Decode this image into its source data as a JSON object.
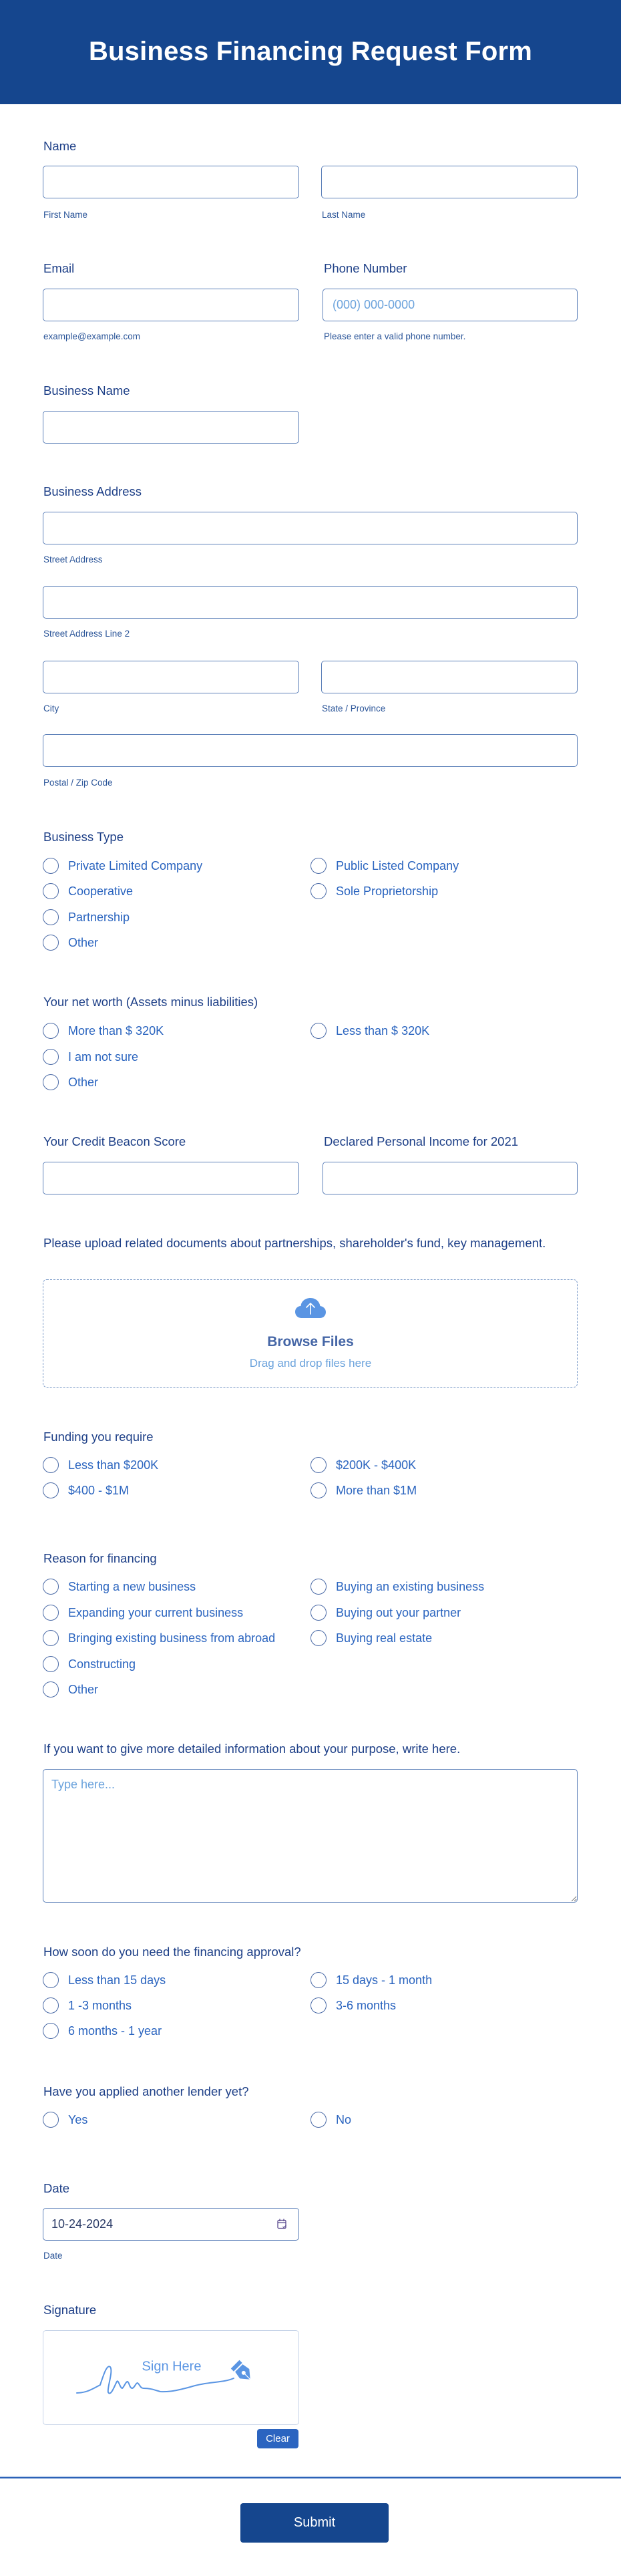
{
  "header": {
    "title": "Business Financing Request Form"
  },
  "name": {
    "label": "Name",
    "first": {
      "value": "",
      "sublabel": "First Name"
    },
    "last": {
      "value": "",
      "sublabel": "Last Name"
    }
  },
  "email": {
    "label": "Email",
    "value": "",
    "sublabel": "example@example.com"
  },
  "phone": {
    "label": "Phone Number",
    "value": "",
    "placeholder": "(000) 000-0000",
    "sublabel": "Please enter a valid phone number."
  },
  "business_name": {
    "label": "Business Name",
    "value": ""
  },
  "business_address": {
    "label": "Business Address",
    "street": {
      "value": "",
      "sublabel": "Street Address"
    },
    "street2": {
      "value": "",
      "sublabel": "Street Address Line 2"
    },
    "city": {
      "value": "",
      "sublabel": "City"
    },
    "state": {
      "value": "",
      "sublabel": "State / Province"
    },
    "postal": {
      "value": "",
      "sublabel": "Postal / Zip Code"
    }
  },
  "business_type": {
    "label": "Business Type",
    "options": [
      "Private Limited Company",
      "Public Listed Company",
      "Cooperative",
      "Sole Proprietorship",
      "Partnership",
      "Other"
    ],
    "selected": null
  },
  "net_worth": {
    "label": "Your net worth (Assets minus liabilities)",
    "options": [
      "More than $ 320K",
      "Less than $ 320K",
      "I am not sure",
      "Other"
    ],
    "selected": null
  },
  "credit_score": {
    "label": "Your Credit Beacon Score",
    "value": ""
  },
  "personal_income": {
    "label": "Declared Personal Income for 2021",
    "value": ""
  },
  "upload": {
    "label": "Please upload related documents about partnerships, shareholder's fund, key management.",
    "browse_label": "Browse Files",
    "drag_hint": "Drag and drop files here",
    "icon": "cloud-upload-icon"
  },
  "funding": {
    "label": "Funding you require",
    "options": [
      "Less than $200K",
      "$200K - $400K",
      "$400 - $1M",
      "More than $1M"
    ],
    "selected": null
  },
  "reason": {
    "label": "Reason for financing",
    "options": [
      "Starting a new business",
      "Buying an existing business",
      "Expanding your current business",
      "Buying out your partner",
      "Bringing existing business from abroad",
      "Buying real estate",
      "Constructing",
      "Other"
    ],
    "selected": null
  },
  "details": {
    "label": "If you want to give more detailed information about your purpose, write here.",
    "value": "",
    "placeholder": "Type here..."
  },
  "approval_time": {
    "label": "How soon do you need the financing approval?",
    "options": [
      "Less than 15 days",
      "15 days - 1 month",
      "1 -3 months",
      "3-6 months",
      "6 months - 1 year"
    ],
    "selected": null
  },
  "other_lender": {
    "label": "Have you applied another lender yet?",
    "options": [
      "Yes",
      "No"
    ],
    "selected": null
  },
  "date": {
    "label": "Date",
    "value": "10-24-2024",
    "sublabel": "Date",
    "icon": "calendar-icon"
  },
  "signature": {
    "label": "Signature",
    "placeholder": "Sign Here",
    "clear_label": "Clear"
  },
  "submit_label": "Submit",
  "colors": {
    "brand": "#15468e",
    "label": "#1d3f87",
    "option": "#2a64bf",
    "placeholder": "#6aa2dc",
    "accent_icon": "#5a95e3",
    "clear_button": "#2b64c0"
  }
}
